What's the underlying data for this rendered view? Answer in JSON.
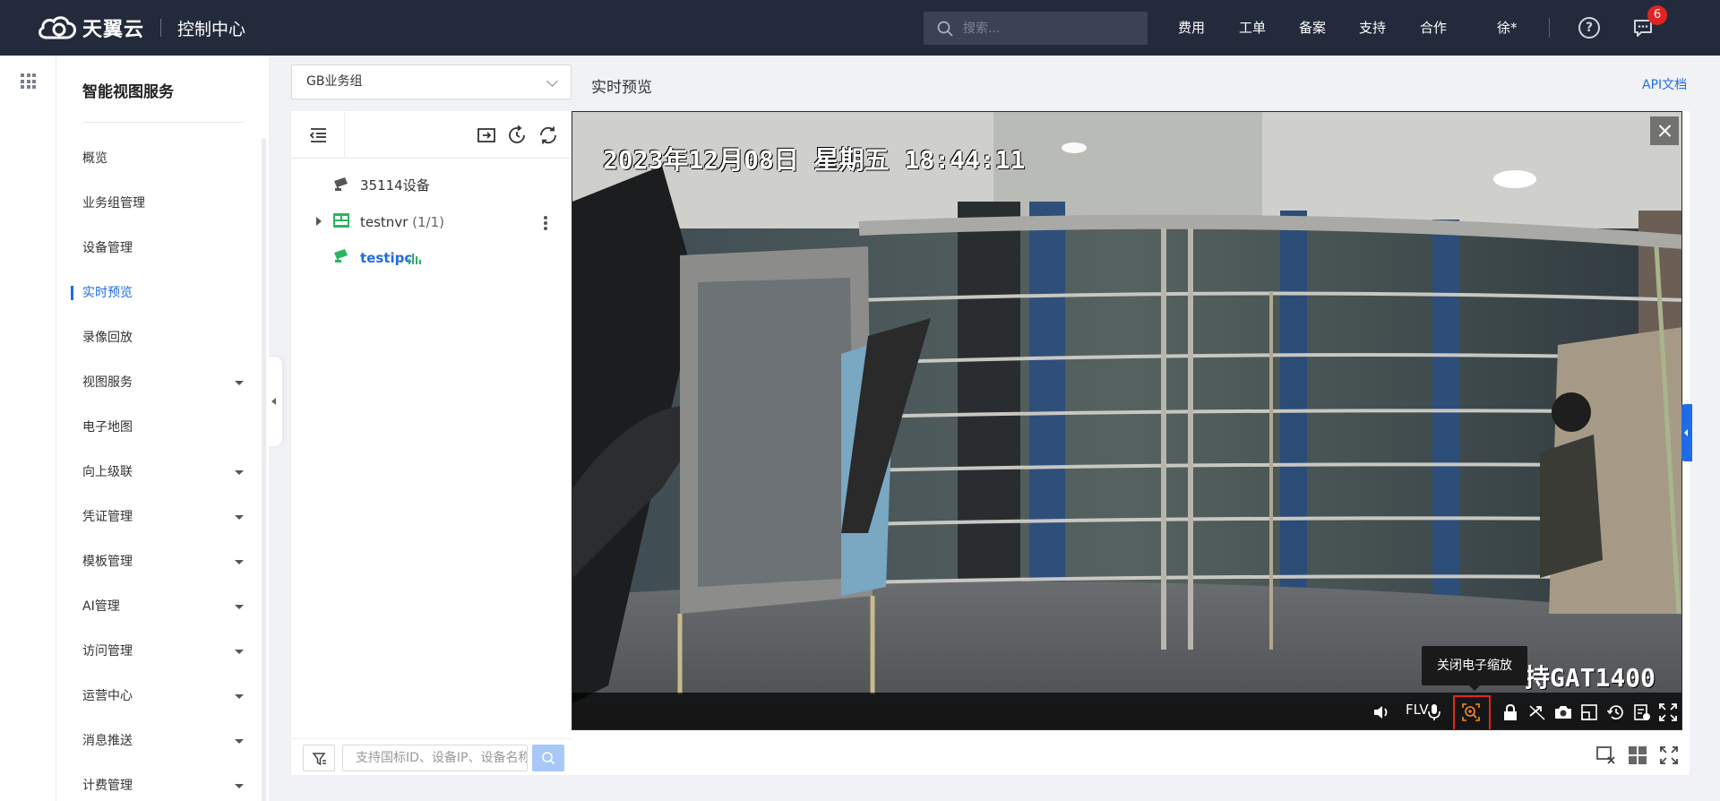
{
  "header": {
    "brand": "天翼云",
    "console": "控制中心",
    "search_placeholder": "搜索...",
    "nav": [
      "费用",
      "工单",
      "备案",
      "支持",
      "合作"
    ],
    "user": "徐*",
    "help": "?",
    "message_count": "6"
  },
  "sidebar": {
    "title": "智能视图服务",
    "items": [
      {
        "label": "概览",
        "has_arrow": false
      },
      {
        "label": "业务组管理",
        "has_arrow": false
      },
      {
        "label": "设备管理",
        "has_arrow": false
      },
      {
        "label": "实时预览",
        "has_arrow": false,
        "active": true
      },
      {
        "label": "录像回放",
        "has_arrow": false
      },
      {
        "label": "视图服务",
        "has_arrow": true
      },
      {
        "label": "电子地图",
        "has_arrow": false
      },
      {
        "label": "向上级联",
        "has_arrow": true
      },
      {
        "label": "凭证管理",
        "has_arrow": true
      },
      {
        "label": "模板管理",
        "has_arrow": true
      },
      {
        "label": "AI管理",
        "has_arrow": true
      },
      {
        "label": "访问管理",
        "has_arrow": true
      },
      {
        "label": "运营中心",
        "has_arrow": true
      },
      {
        "label": "消息推送",
        "has_arrow": true
      },
      {
        "label": "计费管理",
        "has_arrow": true
      }
    ]
  },
  "group_select": {
    "value": "GB业务组"
  },
  "page": {
    "title": "实时预览",
    "api_doc": "API文档"
  },
  "tree": {
    "nodes": [
      {
        "name": "35114设备",
        "suffix": ""
      },
      {
        "name": "testnvr",
        "suffix": "(1/1)"
      },
      {
        "name": "testipc",
        "suffix": ""
      }
    ],
    "search_placeholder": "支持国标ID、设备IP、设备名称"
  },
  "video": {
    "timestamp": "2023年12月08日  星期五  18:44:11",
    "osd_text": "持GAT1400",
    "format": "FLV",
    "tooltip": "关闭电子缩放"
  },
  "colors": {
    "header_bg": "#232a3b",
    "accent": "#1f6be8",
    "active_device": "#2bb361",
    "highlight_box": "#e8241f",
    "badge": "#e22323"
  }
}
